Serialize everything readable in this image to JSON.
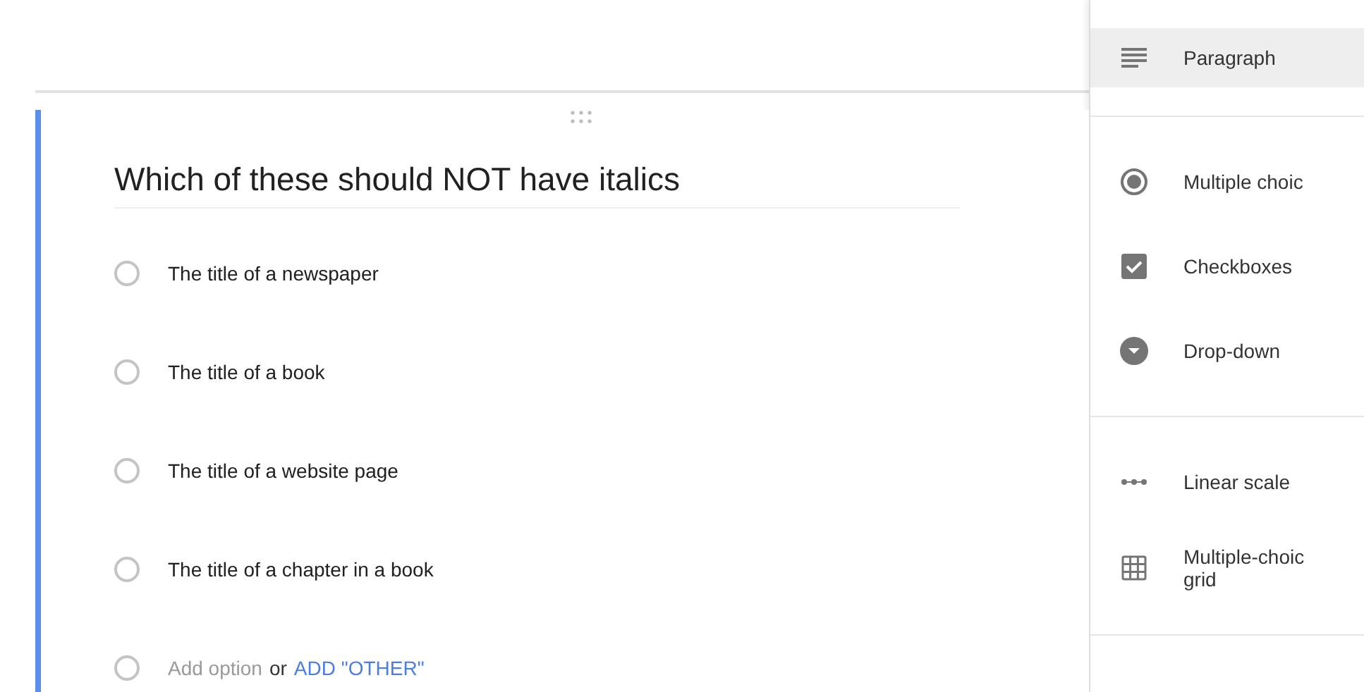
{
  "question": {
    "title": "Which of these should NOT have italics",
    "options": [
      {
        "label": "The title of a newspaper",
        "selected": false
      },
      {
        "label": "The title of a book",
        "selected": false
      },
      {
        "label": "The title of a website page",
        "selected": false
      },
      {
        "label": "The title of a chapter in a book",
        "selected": false
      }
    ],
    "add_option": {
      "selected": false,
      "placeholder": "Add option",
      "joiner": "or",
      "link": "ADD \"OTHER\""
    }
  },
  "type_menu": {
    "sections": [
      [
        {
          "kind": "paragraph",
          "label": "Paragraph",
          "selected": true
        }
      ],
      [
        {
          "kind": "radio",
          "label": "Multiple choic",
          "selected": false
        },
        {
          "kind": "checkbox",
          "label": "Checkboxes",
          "selected": false
        },
        {
          "kind": "dropdown",
          "label": "Drop-down",
          "selected": false
        }
      ],
      [
        {
          "kind": "linear",
          "label": "Linear scale",
          "selected": false
        },
        {
          "kind": "grid",
          "label": "Multiple-choic grid",
          "selected": false
        }
      ]
    ]
  }
}
